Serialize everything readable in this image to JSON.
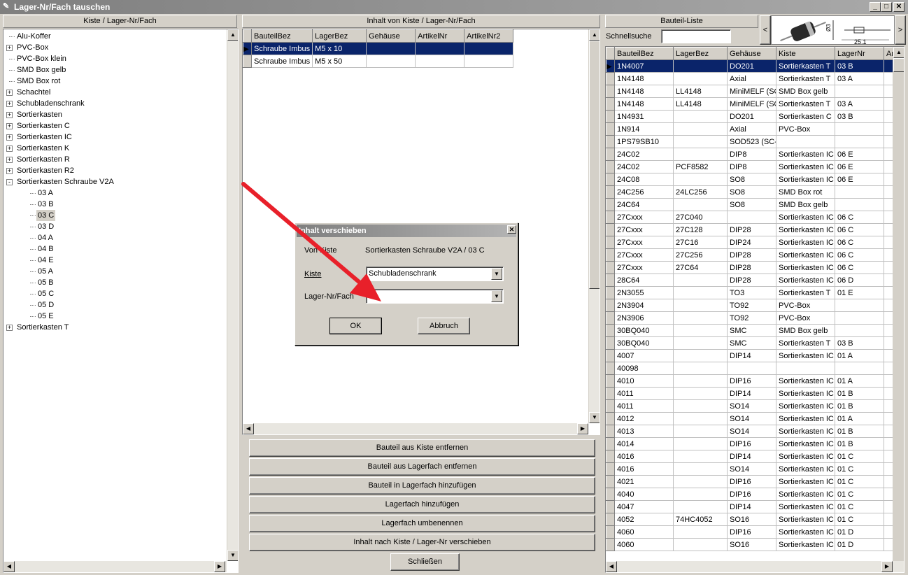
{
  "window": {
    "title": "Lager-Nr/Fach tauschen",
    "min": "_",
    "max": "□",
    "close": "✕"
  },
  "left": {
    "header": "Kiste / Lager-Nr/Fach",
    "tree": [
      {
        "label": "Alu-Koffer",
        "exp": ""
      },
      {
        "label": "PVC-Box",
        "exp": "+"
      },
      {
        "label": "PVC-Box klein",
        "exp": ""
      },
      {
        "label": "SMD Box gelb",
        "exp": ""
      },
      {
        "label": "SMD Box rot",
        "exp": ""
      },
      {
        "label": "Schachtel",
        "exp": "+"
      },
      {
        "label": "Schubladenschrank",
        "exp": "+"
      },
      {
        "label": "Sortierkasten",
        "exp": "+"
      },
      {
        "label": "Sortierkasten C",
        "exp": "+"
      },
      {
        "label": "Sortierkasten IC",
        "exp": "+"
      },
      {
        "label": "Sortierkasten K",
        "exp": "+"
      },
      {
        "label": "Sortierkasten R",
        "exp": "+"
      },
      {
        "label": "Sortierkasten R2",
        "exp": "+"
      },
      {
        "label": "Sortierkasten Schraube V2A",
        "exp": "-"
      },
      {
        "label": "03 A",
        "child": true
      },
      {
        "label": "03 B",
        "child": true
      },
      {
        "label": "03 C",
        "child": true,
        "selected": true
      },
      {
        "label": "03 D",
        "child": true
      },
      {
        "label": "04 A",
        "child": true
      },
      {
        "label": "04 B",
        "child": true
      },
      {
        "label": "04 E",
        "child": true
      },
      {
        "label": "05 A",
        "child": true
      },
      {
        "label": "05 B",
        "child": true
      },
      {
        "label": "05 C",
        "child": true
      },
      {
        "label": "05 D",
        "child": true
      },
      {
        "label": "05 E",
        "child": true
      },
      {
        "label": "Sortierkasten T",
        "exp": "+"
      }
    ]
  },
  "middle": {
    "header": "Inhalt von Kiste / Lager-Nr/Fach",
    "columns": [
      "BauteilBez",
      "LagerBez",
      "Gehäuse",
      "ArtikelNr",
      "ArtikelNr2"
    ],
    "rows": [
      [
        "Schraube Imbus",
        "M5 x 10",
        "",
        "",
        ""
      ],
      [
        "Schraube Imbus",
        "M5 x 50",
        "",
        "",
        ""
      ]
    ],
    "buttons": [
      "Bauteil aus Kiste entfernen",
      "Bauteil aus Lagerfach entfernen",
      "Bauteil in Lagerfach hinzufügen",
      "Lagerfach hinzufügen",
      "Lagerfach umbenennen",
      "Inhalt nach Kiste / Lager-Nr verschieben"
    ],
    "close": "Schließen"
  },
  "right": {
    "header": "Bauteil-Liste",
    "search_label": "Schnellsuche",
    "search_value": "",
    "prev": "<",
    "next": ">",
    "preview_dim": "25.1",
    "columns": [
      "BauteilBez",
      "LagerBez",
      "Gehäuse",
      "Kiste",
      "LagerNr",
      "Ar"
    ],
    "rows": [
      [
        "1N4007",
        "",
        "DO201",
        "Sortierkasten T",
        "03 B",
        ""
      ],
      [
        "1N4148",
        "",
        "Axial",
        "Sortierkasten T",
        "03 A",
        ""
      ],
      [
        "1N4148",
        "LL4148",
        "MiniMELF (SO",
        "SMD Box gelb",
        "",
        ""
      ],
      [
        "1N4148",
        "LL4148",
        "MiniMELF (SO",
        "Sortierkasten T",
        "03 A",
        ""
      ],
      [
        "1N4931",
        "",
        "DO201",
        "Sortierkasten C",
        "03 B",
        ""
      ],
      [
        "1N914",
        "",
        "Axial",
        "PVC-Box",
        "",
        ""
      ],
      [
        "1PS79SB10",
        "",
        "SOD523 (SC-",
        "",
        "",
        ""
      ],
      [
        "24C02",
        "",
        "DIP8",
        "Sortierkasten IC",
        "06 E",
        ""
      ],
      [
        "24C02",
        "PCF8582",
        "DIP8",
        "Sortierkasten IC",
        "06 E",
        ""
      ],
      [
        "24C08",
        "",
        "SO8",
        "Sortierkasten IC",
        "06 E",
        ""
      ],
      [
        "24C256",
        "24LC256",
        "SO8",
        "SMD Box rot",
        "",
        ""
      ],
      [
        "24C64",
        "",
        "SO8",
        "SMD Box gelb",
        "",
        ""
      ],
      [
        "27Cxxx",
        "27C040",
        "",
        "Sortierkasten IC",
        "06 C",
        ""
      ],
      [
        "27Cxxx",
        "27C128",
        "DIP28",
        "Sortierkasten IC",
        "06 C",
        ""
      ],
      [
        "27Cxxx",
        "27C16",
        "DIP24",
        "Sortierkasten IC",
        "06 C",
        ""
      ],
      [
        "27Cxxx",
        "27C256",
        "DIP28",
        "Sortierkasten IC",
        "06 C",
        ""
      ],
      [
        "27Cxxx",
        "27C64",
        "DIP28",
        "Sortierkasten IC",
        "06 C",
        ""
      ],
      [
        "28C64",
        "",
        "DIP28",
        "Sortierkasten IC",
        "06 D",
        ""
      ],
      [
        "2N3055",
        "",
        "TO3",
        "Sortierkasten T",
        "01 E",
        ""
      ],
      [
        "2N3904",
        "",
        "TO92",
        "PVC-Box",
        "",
        ""
      ],
      [
        "2N3906",
        "",
        "TO92",
        "PVC-Box",
        "",
        ""
      ],
      [
        "30BQ040",
        "",
        "SMC",
        "SMD Box gelb",
        "",
        ""
      ],
      [
        "30BQ040",
        "",
        "SMC",
        "Sortierkasten T",
        "03 B",
        ""
      ],
      [
        "4007",
        "",
        "DIP14",
        "Sortierkasten IC",
        "01 A",
        ""
      ],
      [
        "40098",
        "",
        "",
        "",
        "",
        ""
      ],
      [
        "4010",
        "",
        "DIP16",
        "Sortierkasten IC",
        "01 A",
        ""
      ],
      [
        "4011",
        "",
        "DIP14",
        "Sortierkasten IC",
        "01 B",
        ""
      ],
      [
        "4011",
        "",
        "SO14",
        "Sortierkasten IC",
        "01 B",
        ""
      ],
      [
        "4012",
        "",
        "SO14",
        "Sortierkasten IC",
        "01 A",
        ""
      ],
      [
        "4013",
        "",
        "SO14",
        "Sortierkasten IC",
        "01 B",
        ""
      ],
      [
        "4014",
        "",
        "DIP16",
        "Sortierkasten IC",
        "01 B",
        ""
      ],
      [
        "4016",
        "",
        "DIP14",
        "Sortierkasten IC",
        "01 C",
        ""
      ],
      [
        "4016",
        "",
        "SO14",
        "Sortierkasten IC",
        "01 C",
        ""
      ],
      [
        "4021",
        "",
        "DIP16",
        "Sortierkasten IC",
        "01 C",
        ""
      ],
      [
        "4040",
        "",
        "DIP16",
        "Sortierkasten IC",
        "01 C",
        ""
      ],
      [
        "4047",
        "",
        "DIP14",
        "Sortierkasten IC",
        "01 C",
        ""
      ],
      [
        "4052",
        "74HC4052",
        "SO16",
        "Sortierkasten IC",
        "01 C",
        ""
      ],
      [
        "4060",
        "",
        "DIP16",
        "Sortierkasten IC",
        "01 D",
        ""
      ],
      [
        "4060",
        "",
        "SO16",
        "Sortierkasten IC",
        "01 D",
        ""
      ]
    ]
  },
  "dialog": {
    "title": "Inhalt verschieben",
    "von_label": "Von Kiste",
    "von_value": "Sortierkasten Schraube V2A / 03 C",
    "kiste_label": "Kiste",
    "kiste_value": "Schubladenschrank",
    "lager_label": "Lager-Nr/Fach",
    "lager_value": "",
    "ok": "OK",
    "cancel": "Abbruch"
  },
  "colors": {
    "selection": "#0a246a",
    "face": "#d4d0c8",
    "arrow": "#e8202a"
  }
}
